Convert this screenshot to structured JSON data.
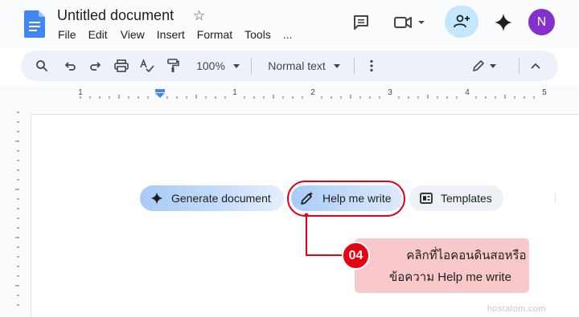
{
  "doc": {
    "title": "Untitled document"
  },
  "menu": [
    "File",
    "Edit",
    "View",
    "Insert",
    "Format",
    "Tools",
    "..."
  ],
  "header": {
    "avatar_initial": "N",
    "avatar_color": "#8430ce",
    "share_bg": "#c2e7ff"
  },
  "toolbar": {
    "zoom": "100%",
    "style": "Normal text"
  },
  "ruler": {
    "numbers": [
      "1",
      "1",
      "2",
      "3",
      "4",
      "5"
    ]
  },
  "chips": {
    "generate": "Generate document",
    "help": "Help me write",
    "templates": "Templates"
  },
  "annotation": {
    "step": "04",
    "line1": "คลิกที่ไอคอนดินสอหรือ",
    "line2": "ข้อความ Help me write",
    "accent": "#e60012",
    "bg": "#f9c8ca"
  },
  "watermark": "hostatom.com"
}
